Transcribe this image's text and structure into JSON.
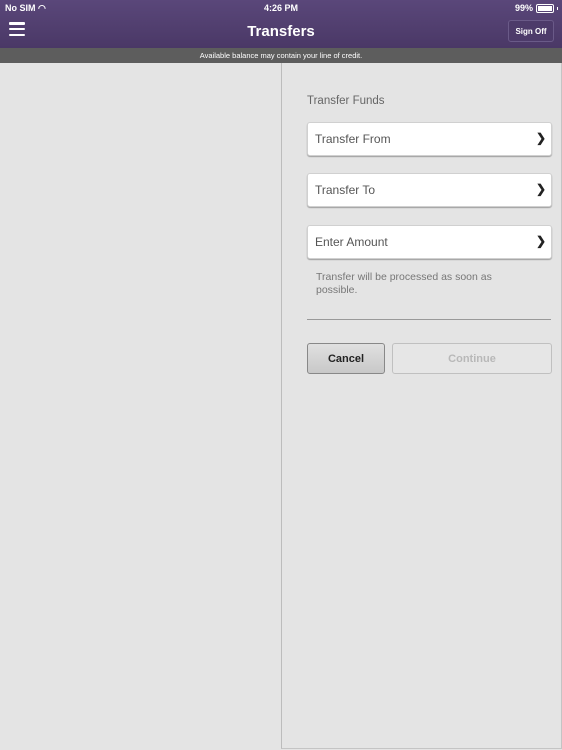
{
  "status_bar": {
    "carrier": "No SIM",
    "time": "4:26 PM",
    "battery": "99%"
  },
  "header": {
    "title": "Transfers",
    "sign_off_label": "Sign Off"
  },
  "notice": "Available balance may contain your line of credit.",
  "form": {
    "section_title": "Transfer Funds",
    "fields": [
      {
        "label": "Transfer From"
      },
      {
        "label": "Transfer To"
      },
      {
        "label": "Enter Amount"
      }
    ],
    "note": "Transfer will be processed as soon as possible.",
    "cancel_label": "Cancel",
    "continue_label": "Continue"
  },
  "icons": {
    "menu": "hamburger-menu-icon",
    "wifi": "wifi-icon",
    "battery": "battery-icon",
    "chevron": "chevron-right-icon"
  }
}
